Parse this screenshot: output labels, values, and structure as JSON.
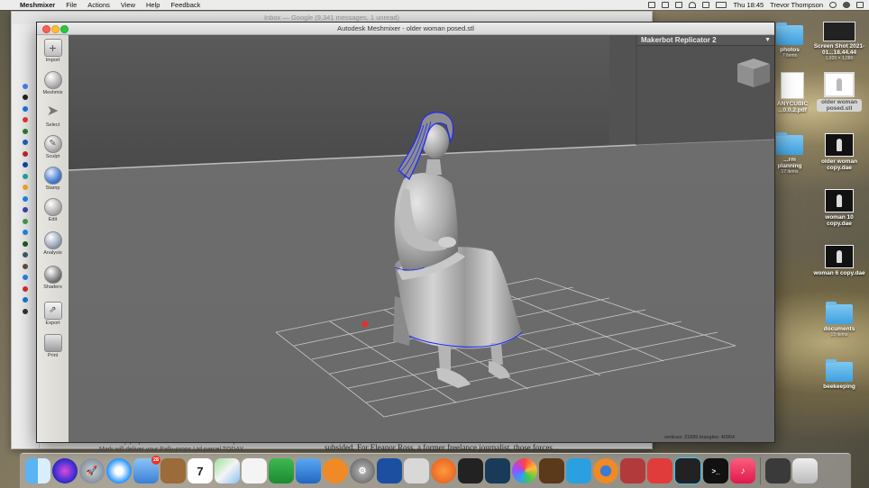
{
  "menubar": {
    "apple_glyph": "",
    "app_name": "Meshmixer",
    "menus": [
      "File",
      "Actions",
      "View",
      "Help",
      "Feedback"
    ],
    "clock": "Thu 18:45",
    "user": "Trevor Thompson"
  },
  "background_mail": {
    "title": "Inbox — Google (9,341 messages, 1 unread)",
    "snippet_line1": "Your Pally-props Ltd order will be delivered today 5...",
    "snippet_line2": "Mark will deliver your Pally-props Ltd parcel TODAY"
  },
  "background_article": {
    "text": "subsided. For Eleanor Ross, a former freelance journalist, those forces..."
  },
  "meshmixer": {
    "window_title": "Autodesk Meshmixer - older woman posed.stl",
    "printer": "Makerbot Replicator 2",
    "status": "vertices: 21895  triangles: 40904",
    "tools": [
      {
        "label": "Import",
        "icon": "import-icon"
      },
      {
        "label": "Meshmix",
        "icon": "meshmix-icon"
      },
      {
        "label": "Select",
        "icon": "select-icon"
      },
      {
        "label": "Sculpt",
        "icon": "sculpt-icon"
      },
      {
        "label": "Stamp",
        "icon": "stamp-icon"
      },
      {
        "label": "Edit",
        "icon": "edit-icon"
      },
      {
        "label": "Analysis",
        "icon": "analysis-icon"
      },
      {
        "label": "Shaders",
        "icon": "shaders-icon"
      },
      {
        "label": "Export",
        "icon": "export-icon"
      },
      {
        "label": "Print",
        "icon": "print-icon"
      }
    ]
  },
  "desktop": {
    "items": [
      {
        "name": "photos",
        "sub": "7 items",
        "kind": "folder"
      },
      {
        "name": "Screen Shot 2021-01...18.44.44",
        "sub": "1,920 × 1,080",
        "kind": "screenshot"
      },
      {
        "name": "ANYCUBIC ...0.0.2.pdf",
        "sub": "",
        "kind": "doc"
      },
      {
        "name": "older woman posed.stl",
        "sub": "",
        "kind": "file-selected"
      },
      {
        "name": "...rm planning",
        "sub": "17 items",
        "kind": "folder"
      },
      {
        "name": "older woman copy.dae",
        "sub": "",
        "kind": "file"
      },
      {
        "name": "woman 10 copy.dae",
        "sub": "",
        "kind": "file"
      },
      {
        "name": "woman 6 copy.dae",
        "sub": "",
        "kind": "file"
      },
      {
        "name": "documents",
        "sub": "15 items",
        "kind": "folder"
      },
      {
        "name": "beekeeping",
        "sub": "",
        "kind": "folder"
      }
    ]
  },
  "dock": {
    "calendar_day": "7",
    "mail_badge": "28"
  },
  "colors": {
    "viewport_bg": "#7b7b7b",
    "grid_line": "#d8d8d8",
    "model_gray": "#b9b9b9",
    "selection_blue": "#1e2aff",
    "pivot_red": "#e23030"
  }
}
